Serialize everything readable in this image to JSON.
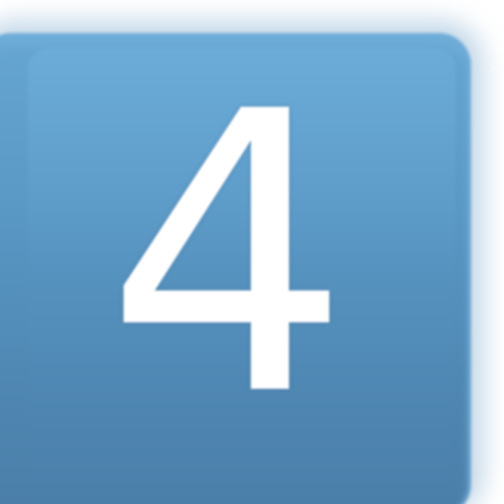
{
  "pagination": {
    "current_page_label": "4"
  },
  "colors": {
    "button_top": "#66a6d3",
    "button_bottom": "#4a7ea8",
    "digit": "#ffffff",
    "background": "#ffffff"
  }
}
